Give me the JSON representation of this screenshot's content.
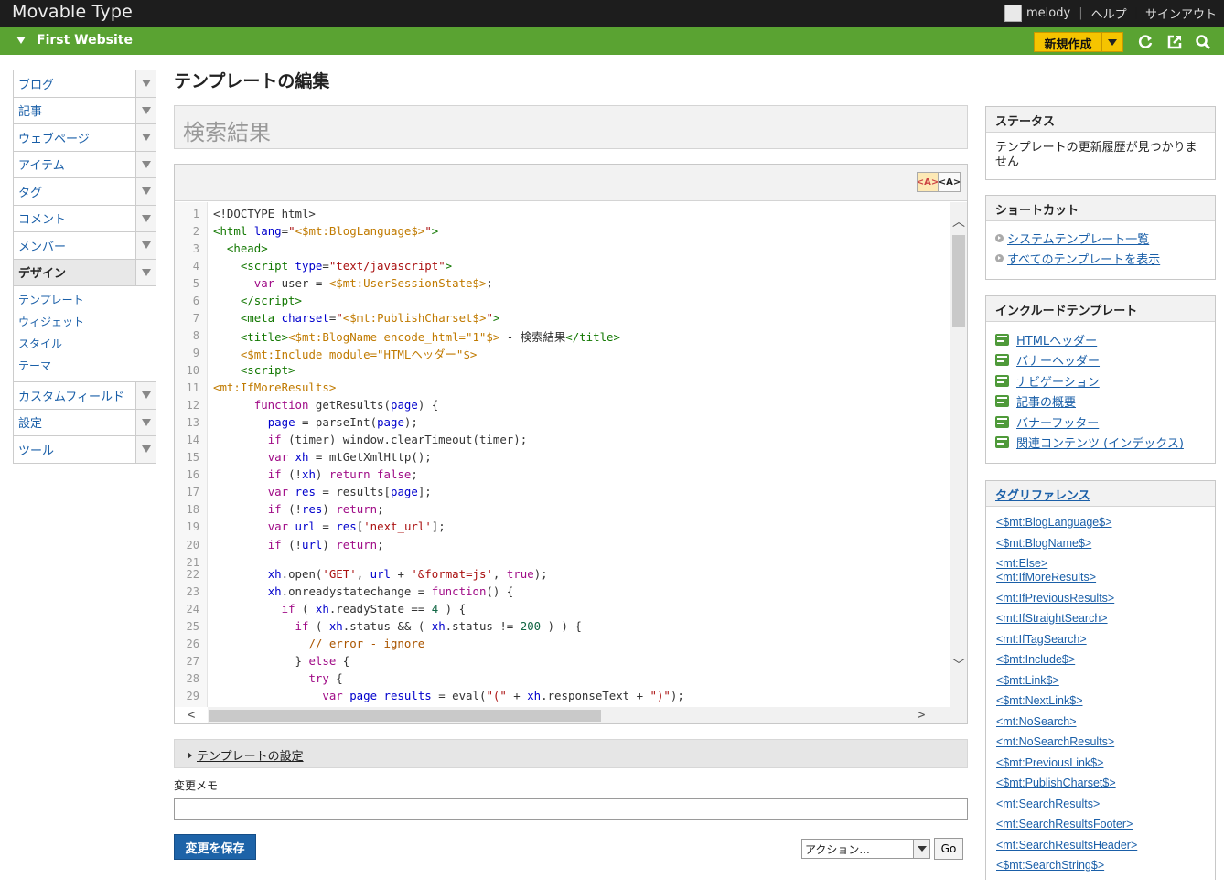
{
  "app": {
    "logo": "Movable Type"
  },
  "user": {
    "name": "melody",
    "help": "ヘルプ",
    "signout": "サインアウト"
  },
  "site": {
    "name": "First Website",
    "new_label": "新規作成"
  },
  "nav": {
    "items": [
      {
        "label": "ブログ"
      },
      {
        "label": "記事"
      },
      {
        "label": "ウェブページ"
      },
      {
        "label": "アイテム"
      },
      {
        "label": "タグ"
      },
      {
        "label": "コメント"
      },
      {
        "label": "メンバー"
      },
      {
        "label": "デザイン"
      }
    ],
    "design_sub": [
      "テンプレート",
      "ウィジェット",
      "スタイル",
      "テーマ"
    ],
    "items_after": [
      {
        "label": "カスタムフィールド"
      },
      {
        "label": "設定"
      },
      {
        "label": "ツール"
      }
    ]
  },
  "main": {
    "title": "テンプレートの編集",
    "template_name": "検索結果",
    "settings_label": "テンプレートの設定",
    "memo_label": "変更メモ",
    "memo_value": "",
    "save_label": "変更を保存",
    "action_value": "アクション...",
    "go_label": "Go"
  },
  "editor": {
    "line_numbers": [
      "1",
      "2",
      "3",
      "4",
      "5",
      "6",
      "7",
      "8",
      "9",
      "10",
      "11",
      "12",
      "13",
      "14",
      "15",
      "16",
      "17",
      "18",
      "19",
      "20",
      "21",
      "22",
      "23",
      "24",
      "25",
      "26",
      "27",
      "28",
      "29"
    ]
  },
  "status": {
    "title": "ステータス",
    "message": "テンプレートの更新履歴が見つかりません"
  },
  "shortcuts": {
    "title": "ショートカット",
    "items": [
      "システムテンプレート一覧",
      "すべてのテンプレートを表示"
    ]
  },
  "includes": {
    "title": "インクルードテンプレート",
    "items": [
      "HTMLヘッダー",
      "バナーヘッダー",
      "ナビゲーション",
      "記事の概要",
      "バナーフッター",
      "関連コンテンツ (インデックス)"
    ]
  },
  "tagref": {
    "title": "タグリファレンス",
    "items": [
      "<$mt:BlogLanguage$>",
      "<$mt:BlogName$>",
      "<mt:Else>",
      "<mt:IfMoreResults>",
      "<mt:IfPreviousResults>",
      "<mt:IfStraightSearch>",
      "<mt:IfTagSearch>",
      "<$mt:Include$>",
      "<$mt:Link$>",
      "<$mt:NextLink$>",
      "<mt:NoSearch>",
      "<mt:NoSearchResults>",
      "<$mt:PreviousLink$>",
      "<$mt:PublishCharset$>",
      "<mt:SearchResults>",
      "<mt:SearchResultsFooter>",
      "<mt:SearchResultsHeader>",
      "<$mt:SearchString$>"
    ]
  },
  "colors": {
    "header_bg": "#1d1d1d",
    "site_bar": "#5aa332",
    "new_button": "#f5c400",
    "save_button": "#1d63a8",
    "link": "#1a5fa8"
  },
  "icons": [
    "refresh-icon",
    "external-link-icon",
    "search-icon",
    "chevron-down-icon",
    "include-template-icon",
    "shortcut-bullet-icon"
  ]
}
